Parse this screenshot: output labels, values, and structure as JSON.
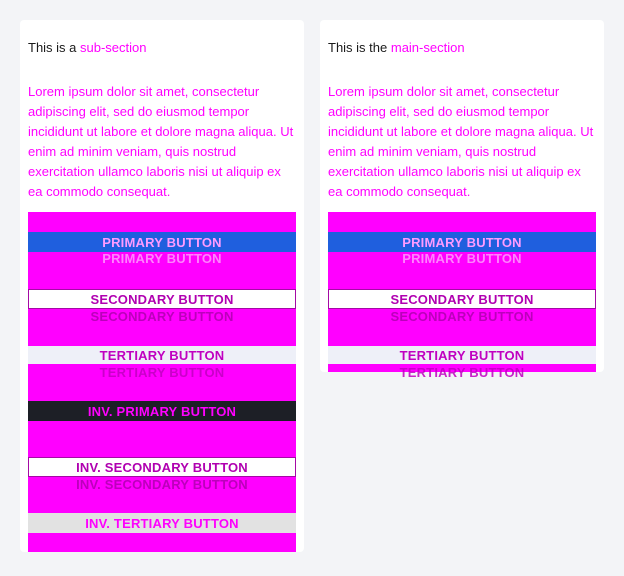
{
  "left": {
    "heading_prefix": "This is a ",
    "heading_accent": "sub-section",
    "body": "Lorem ipsum dolor sit amet, consectetur adipiscing elit, sed do eiusmod tempor incididunt ut labore et dolore magna aliqua. Ut enim ad minim veniam, quis nostrud exercitation ullamco laboris nisi ut aliquip ex ea commodo consequat.",
    "buttons": {
      "primary": "PRIMARY BUTTON",
      "secondary": "SECONDARY BUTTON",
      "tertiary": "TERTIARY BUTTON",
      "inv_primary": "INV. PRIMARY BUTTON",
      "inv_secondary": "INV. SECONDARY BUTTON",
      "inv_tertiary": "INV. TERTIARY BUTTON"
    }
  },
  "right": {
    "heading_prefix": "This is the ",
    "heading_accent": "main-section",
    "body": "Lorem ipsum dolor sit amet, consectetur adipiscing elit, sed do eiusmod tempor incididunt ut labore et dolore magna aliqua. Ut enim ad minim veniam, quis nostrud exercitation ullamco laboris nisi ut aliquip ex ea commodo consequat.",
    "buttons": {
      "primary": "PRIMARY BUTTON",
      "secondary": "SECONDARY BUTTON",
      "tertiary": "TERTIARY BUTTON"
    }
  },
  "colors": {
    "page_bg": "#f3f4f7",
    "card_bg": "#ffffff",
    "accent_magenta": "#ff00ff",
    "primary_blue": "#1f5fde",
    "dark": "#1d1f26"
  }
}
